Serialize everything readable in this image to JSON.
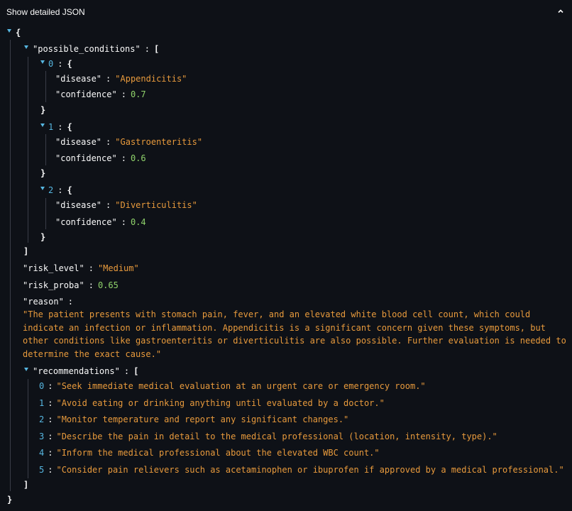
{
  "expander": {
    "label": "Show detailed JSON",
    "chevron_icon": "chevron-up-icon"
  },
  "json": {
    "possible_conditions_key": "\"possible_conditions\"",
    "conditions": [
      {
        "index": "0",
        "disease_key": "\"disease\"",
        "disease": "\"Appendicitis\"",
        "confidence_key": "\"confidence\"",
        "confidence": "0.7"
      },
      {
        "index": "1",
        "disease_key": "\"disease\"",
        "disease": "\"Gastroenteritis\"",
        "confidence_key": "\"confidence\"",
        "confidence": "0.6"
      },
      {
        "index": "2",
        "disease_key": "\"disease\"",
        "disease": "\"Diverticulitis\"",
        "confidence_key": "\"confidence\"",
        "confidence": "0.4"
      }
    ],
    "risk_level_key": "\"risk_level\"",
    "risk_level": "\"Medium\"",
    "risk_proba_key": "\"risk_proba\"",
    "risk_proba": "0.65",
    "reason_key": "\"reason\"",
    "reason": "\"The patient presents with stomach pain, fever, and an elevated white blood cell count, which could indicate an infection or inflammation. Appendicitis is a significant concern given these symptoms, but other conditions like gastroenteritis or diverticulitis are also possible. Further evaluation is needed to determine the exact cause.\"",
    "recommendations_key": "\"recommendations\"",
    "recommendations": [
      {
        "index": "0",
        "text": "\"Seek immediate medical evaluation at an urgent care or emergency room.\""
      },
      {
        "index": "1",
        "text": "\"Avoid eating or drinking anything until evaluated by a doctor.\""
      },
      {
        "index": "2",
        "text": "\"Monitor temperature and report any significant changes.\""
      },
      {
        "index": "3",
        "text": "\"Describe the pain in detail to the medical professional (location, intensity, type).\""
      },
      {
        "index": "4",
        "text": "\"Inform the medical professional about the elevated WBC count.\""
      },
      {
        "index": "5",
        "text": "\"Consider pain relievers such as acetaminophen or ibuprofen if approved by a medical professional.\""
      }
    ]
  },
  "colors": {
    "background": "#0e1117",
    "index": "#56b6e0",
    "string": "#e89a3c",
    "number": "#8fd26b",
    "guide": "#3a3d48"
  }
}
